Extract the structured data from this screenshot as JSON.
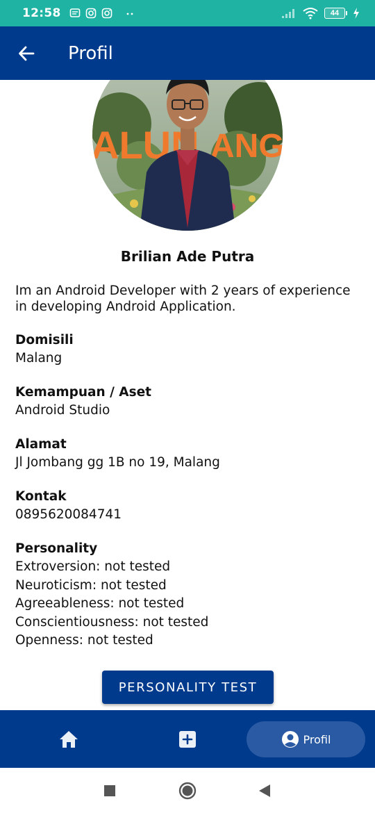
{
  "status_bar": {
    "time": "12:58",
    "battery": "44",
    "icons_left": [
      "message-icon",
      "instagram-icon",
      "instagram-icon",
      "more-dots-icon"
    ],
    "icons_right": [
      "signal-icon",
      "wifi-icon",
      "battery-icon",
      "charging-icon"
    ]
  },
  "app_bar": {
    "title": "Profil",
    "back_icon": "arrow-left-icon"
  },
  "profile": {
    "name": "Brilian Ade Putra",
    "bio": "Im an Android Developer with 2 years of experience in developing Android Application.",
    "fields": [
      {
        "label": "Domisili",
        "value": "Malang"
      },
      {
        "label": "Kemampuan / Aset",
        "value": "Android Studio"
      },
      {
        "label": "Alamat",
        "value": "Jl Jombang gg 1B no 19, Malang"
      },
      {
        "label": "Kontak",
        "value": "0895620084741"
      }
    ],
    "personality": {
      "label": "Personality",
      "items": [
        "Extroversion: not tested",
        "Neuroticism: not tested",
        "Agreeableness: not tested",
        "Conscientiousness: not tested",
        "Openness: not tested"
      ]
    },
    "test_button_label": "PERSONALITY TEST"
  },
  "bottom_nav": {
    "items": [
      {
        "icon": "home-icon",
        "label": ""
      },
      {
        "icon": "add-box-icon",
        "label": ""
      },
      {
        "icon": "account-circle-icon",
        "label": "Profil",
        "active": true
      }
    ]
  },
  "system_nav": [
    "recents-square-icon",
    "home-circle-icon",
    "back-triangle-icon"
  ],
  "colors": {
    "primary": "#003a8c",
    "active_pill": "#2a5aa3",
    "status_bar": "#1fb3a3",
    "background": "#ffffff"
  }
}
